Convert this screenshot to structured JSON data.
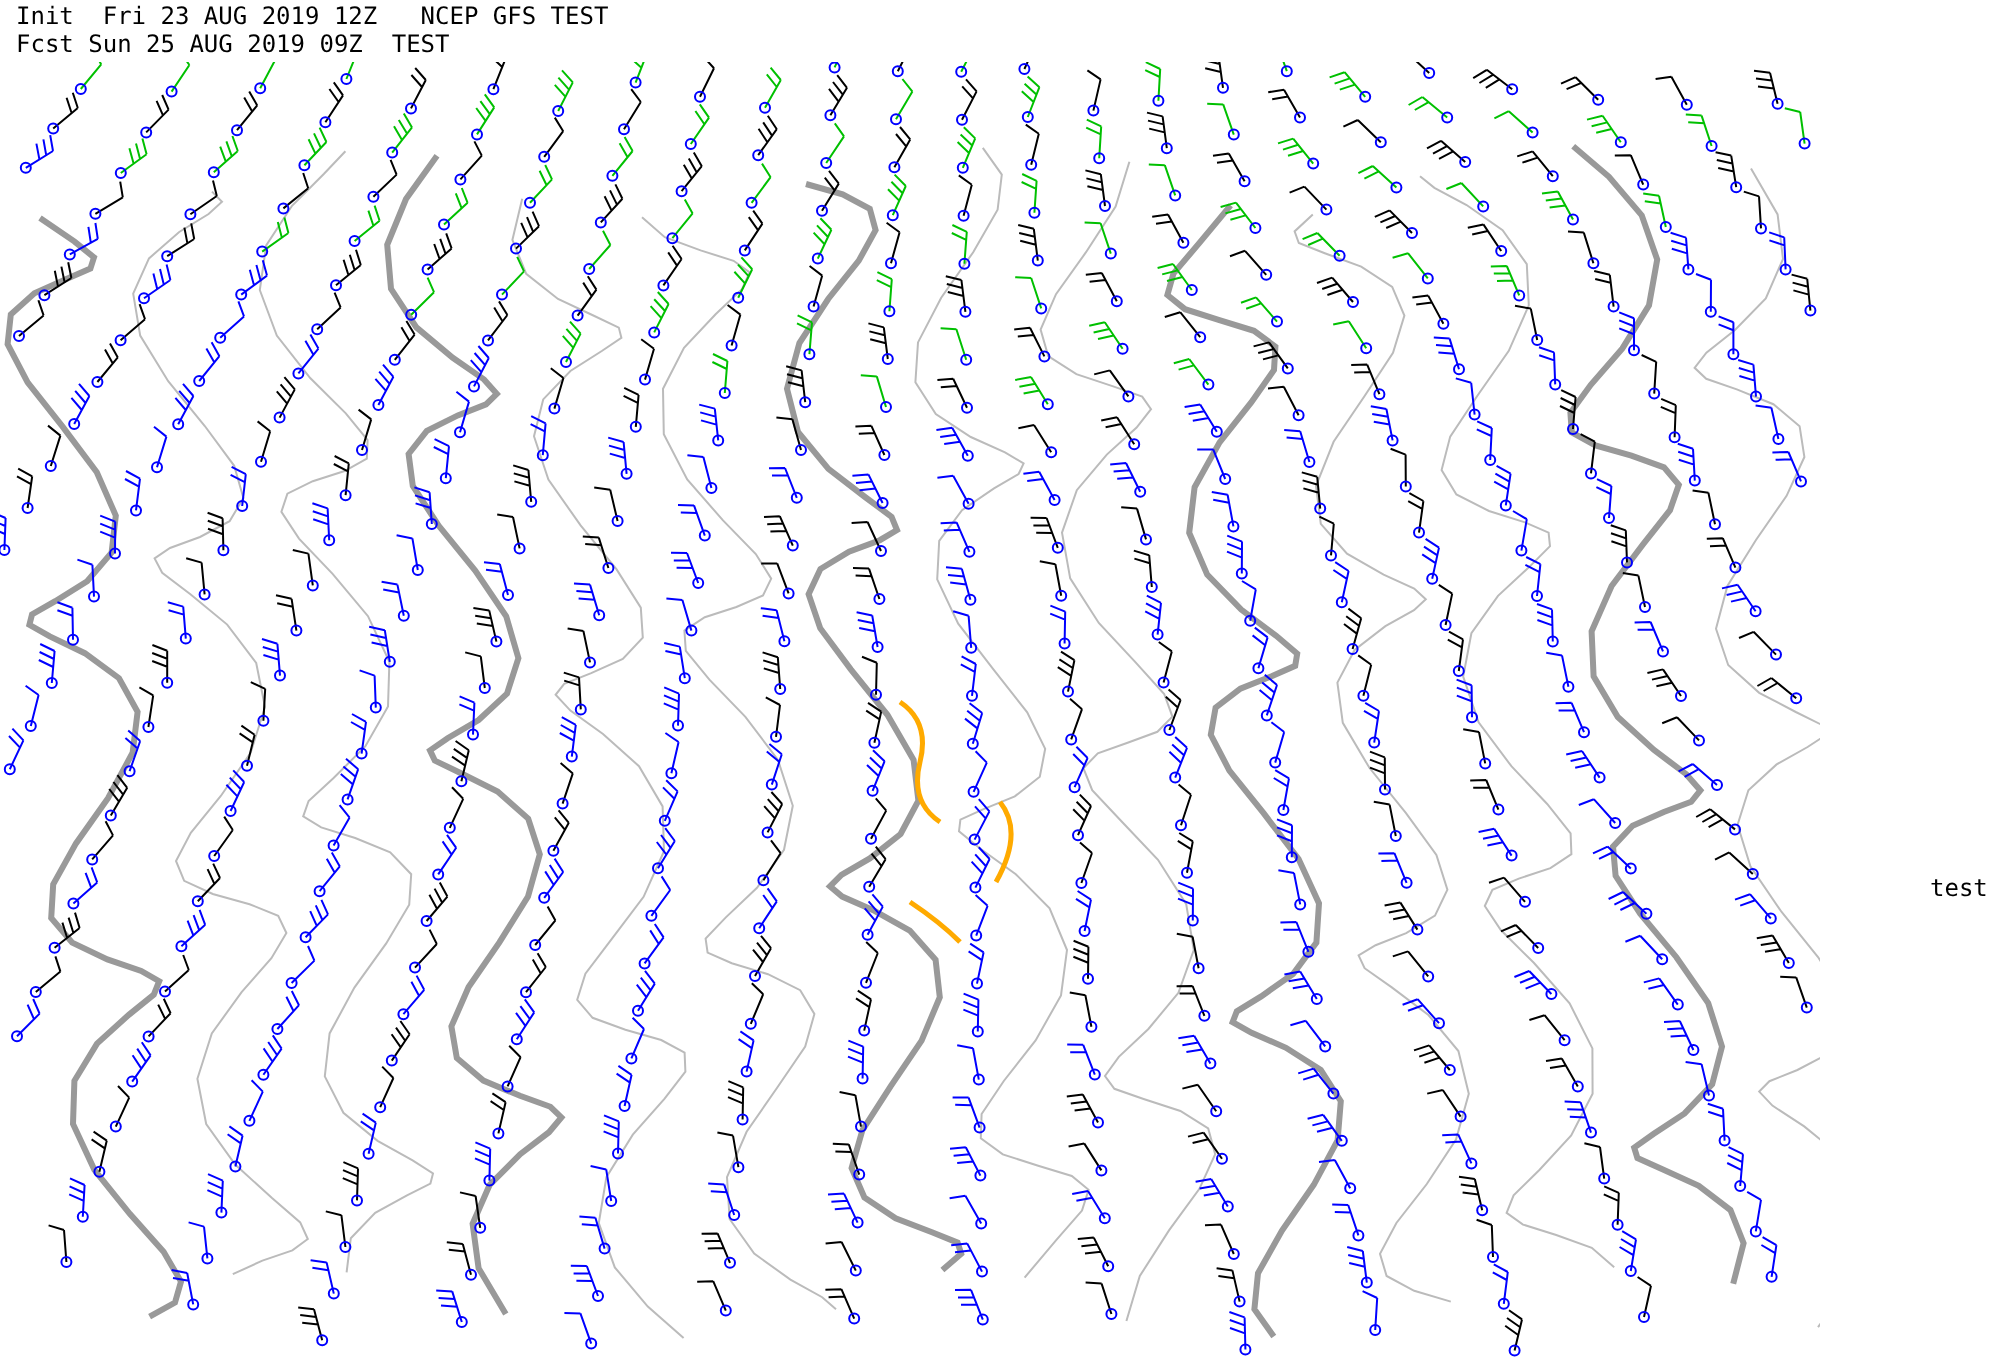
{
  "header": {
    "init_line": "Init  Fri 23 AUG 2019 12Z   NCEP GFS TEST",
    "forecast_line": "Fcst Sun 25 AUG 2019 09Z  TEST"
  },
  "side_label": "test"
}
